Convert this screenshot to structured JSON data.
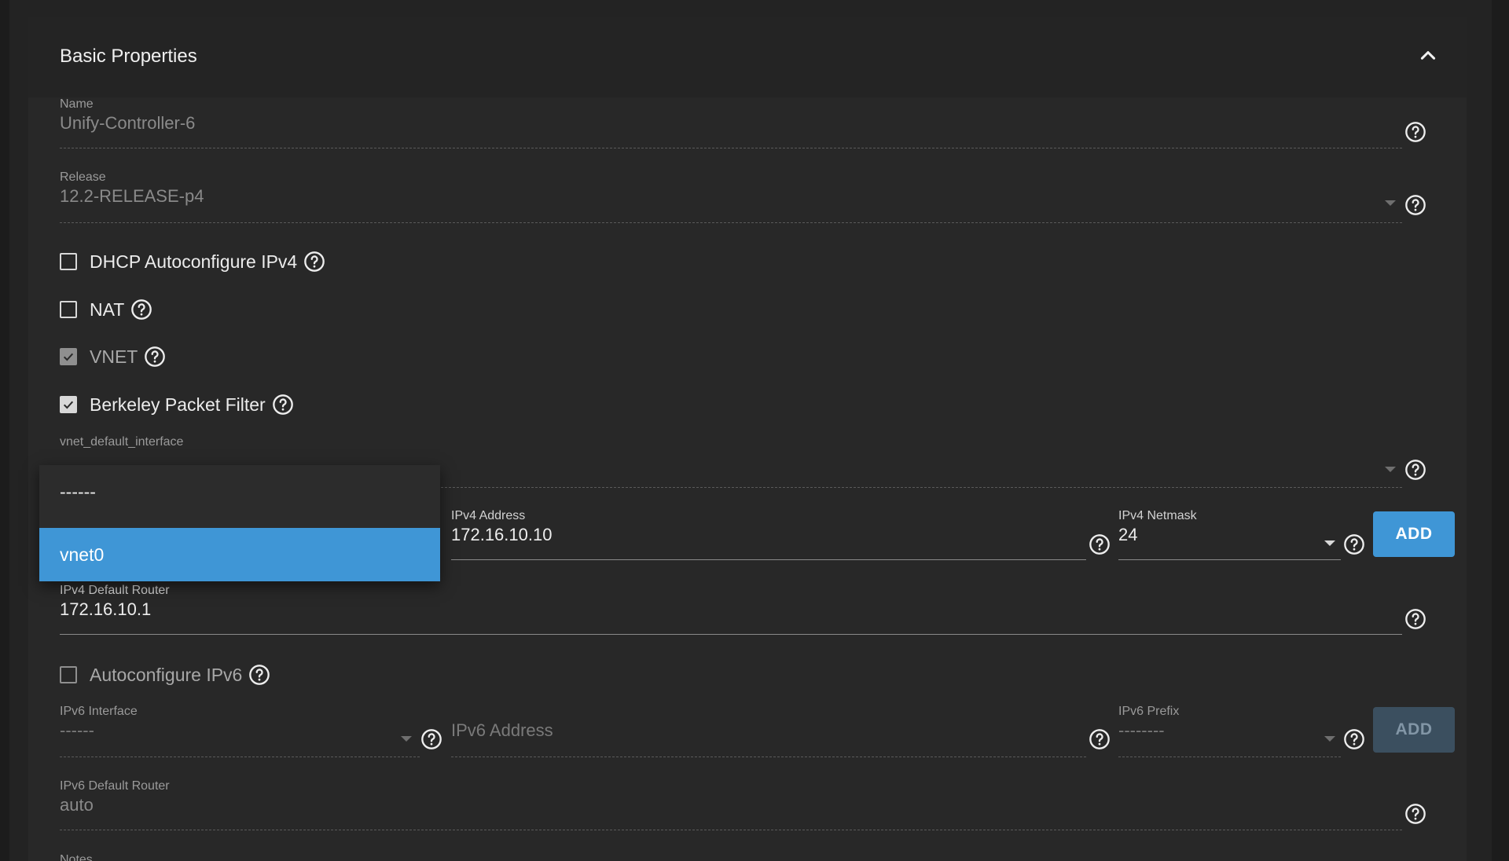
{
  "section": {
    "title": "Basic Properties"
  },
  "name_field": {
    "label": "Name",
    "value": "Unify-Controller-6"
  },
  "release_field": {
    "label": "Release",
    "value": "12.2-RELEASE-p4"
  },
  "checkboxes": {
    "dhcp": {
      "label": "DHCP Autoconfigure IPv4",
      "checked": false
    },
    "nat": {
      "label": "NAT",
      "checked": false
    },
    "vnet": {
      "label": "VNET",
      "checked": true,
      "disabled": true
    },
    "bpf": {
      "label": "Berkeley Packet Filter",
      "checked": true
    },
    "autoconf_ipv6": {
      "label": "Autoconfigure IPv6",
      "checked": false
    }
  },
  "vnet_default_interface": {
    "label": "vnet_default_interface"
  },
  "dropdown": {
    "options": [
      {
        "label": "------",
        "selected": false
      },
      {
        "label": "vnet0",
        "selected": true
      }
    ]
  },
  "ipv4": {
    "address_label": "IPv4 Address",
    "address_value": "172.16.10.10",
    "netmask_label": "IPv4 Netmask",
    "netmask_value": "24",
    "add_label": "ADD",
    "default_router_label": "IPv4 Default Router",
    "default_router_value": "172.16.10.1"
  },
  "ipv6": {
    "interface_label": "IPv6 Interface",
    "interface_value": "------",
    "address_placeholder": "IPv6 Address",
    "prefix_label": "IPv6 Prefix",
    "prefix_value": "--------",
    "add_label": "ADD",
    "default_router_label": "IPv6 Default Router",
    "default_router_value": "auto"
  },
  "notes": {
    "label": "Notes"
  },
  "icons": {
    "help": "help-circle-icon",
    "collapse": "chevron-up-icon",
    "check": "check-icon",
    "dropdown": "caret-down-icon"
  },
  "colors": {
    "accent": "#3f96d6",
    "background": "#232323",
    "card": "#282828"
  }
}
